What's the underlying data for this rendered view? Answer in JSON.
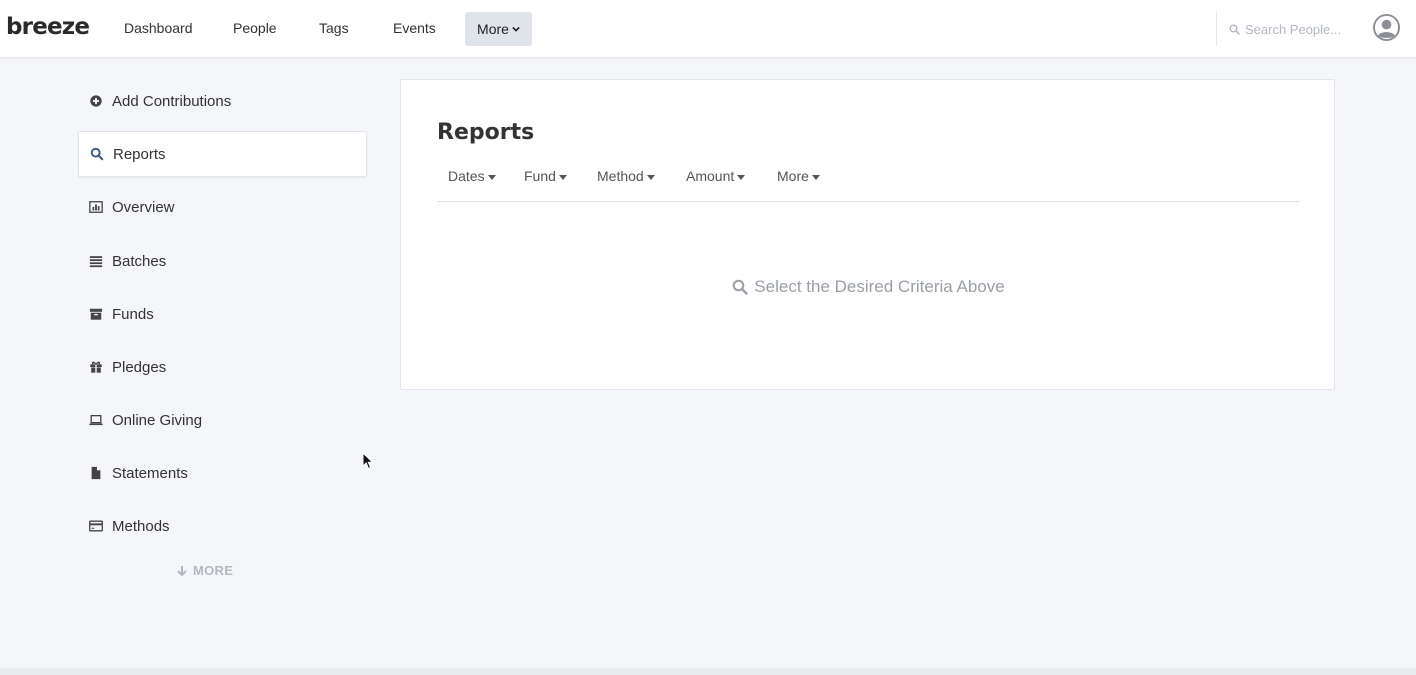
{
  "brand": {
    "logo_text": "breeze"
  },
  "topnav": {
    "links": [
      "Dashboard",
      "People",
      "Tags",
      "Events"
    ],
    "more_label": "More",
    "search_placeholder": "Search People..."
  },
  "sidebar": {
    "items": [
      {
        "label": "Add Contributions",
        "icon": "plus-circle-icon",
        "active": false
      },
      {
        "label": "Reports",
        "icon": "search-icon",
        "active": true
      },
      {
        "label": "Overview",
        "icon": "bar-chart-icon",
        "active": false
      },
      {
        "label": "Batches",
        "icon": "list-icon",
        "active": false
      },
      {
        "label": "Funds",
        "icon": "archive-icon",
        "active": false
      },
      {
        "label": "Pledges",
        "icon": "gift-icon",
        "active": false
      },
      {
        "label": "Online Giving",
        "icon": "laptop-icon",
        "active": false
      },
      {
        "label": "Statements",
        "icon": "file-icon",
        "active": false
      },
      {
        "label": "Methods",
        "icon": "credit-card-icon",
        "active": false
      }
    ],
    "more_label": "MORE"
  },
  "reports": {
    "title": "Reports",
    "filters": [
      "Dates",
      "Fund",
      "Method",
      "Amount",
      "More"
    ],
    "empty_message": "Select the Desired Criteria Above"
  },
  "colors": {
    "background": "#f5f6f9",
    "panel": "#ffffff",
    "nav_more_bg": "#dfe3ea",
    "muted_text": "#9a9fa6",
    "active_icon": "#3a5b8c"
  }
}
